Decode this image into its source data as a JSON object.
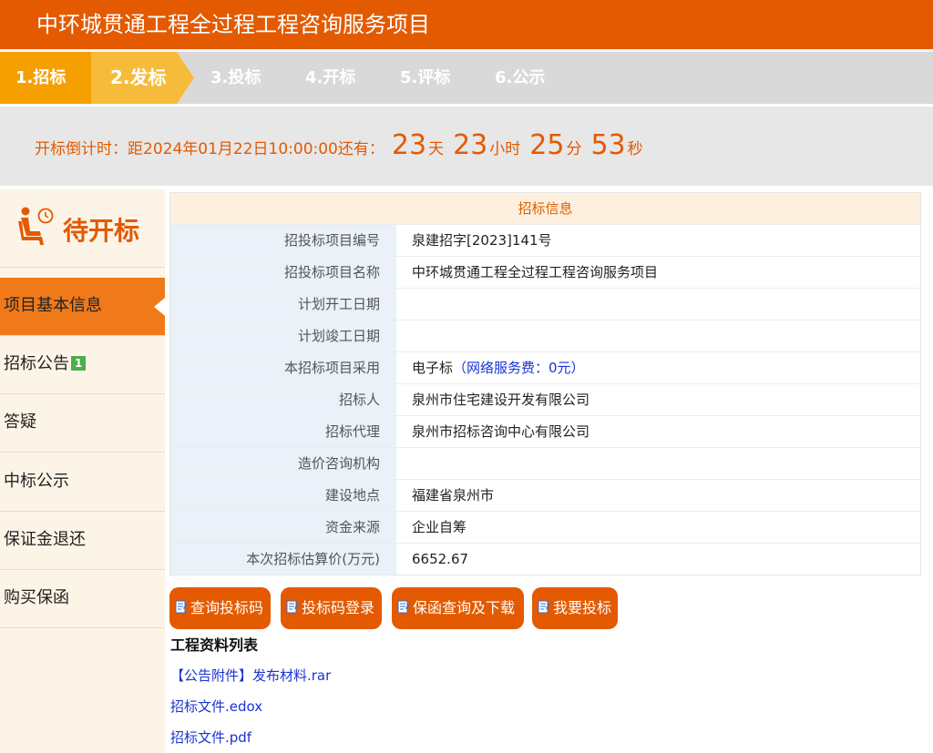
{
  "header": {
    "title": "中环城贯通工程全过程工程咨询服务项目"
  },
  "steps": [
    {
      "label": "1.招标",
      "state": "done"
    },
    {
      "label": "2.发标",
      "state": "current"
    },
    {
      "label": "3.投标",
      "state": "pending"
    },
    {
      "label": "4.开标",
      "state": "pending"
    },
    {
      "label": "5.评标",
      "state": "pending"
    },
    {
      "label": "6.公示",
      "state": "pending"
    }
  ],
  "countdown": {
    "label": "开标倒计时：距2024年01月22日10:00:00还有：",
    "days": "23",
    "days_unit": "天",
    "hours": "23",
    "hours_unit": "小时",
    "minutes": "25",
    "minutes_unit": "分",
    "seconds": "53",
    "seconds_unit": "秒"
  },
  "sidebar": {
    "status": "待开标",
    "status_icon": "person-waiting-clock-icon",
    "items": [
      {
        "label": "项目基本信息",
        "active": true
      },
      {
        "label": "招标公告",
        "badge": "1"
      },
      {
        "label": "答疑"
      },
      {
        "label": "中标公示"
      },
      {
        "label": "保证金退还"
      },
      {
        "label": "购买保函"
      }
    ]
  },
  "info": {
    "title": "招标信息",
    "rows": [
      {
        "label": "招投标项目编号",
        "value": "泉建招字[2023]141号"
      },
      {
        "label": "招投标项目名称",
        "value": "中环城贯通工程全过程工程咨询服务项目"
      },
      {
        "label": "计划开工日期",
        "value": ""
      },
      {
        "label": "计划竣工日期",
        "value": ""
      },
      {
        "label": "本招标项目采用",
        "value": "电子标",
        "note": "（网络服务费：0元）"
      },
      {
        "label": "招标人",
        "value": "泉州市住宅建设开发有限公司"
      },
      {
        "label": "招标代理",
        "value": "泉州市招标咨询中心有限公司"
      },
      {
        "label": "造价咨询机构",
        "value": ""
      },
      {
        "label": "建设地点",
        "value": "福建省泉州市"
      },
      {
        "label": "资金来源",
        "value": "企业自筹"
      },
      {
        "label": "本次招标估算价(万元)",
        "value": "6652.67"
      }
    ]
  },
  "buttons": {
    "query_code": "查询投标码",
    "code_login": "投标码登录",
    "guarantee_query": "保函查询及下载",
    "bid": "我要投标"
  },
  "files": {
    "title": "工程资料列表",
    "items": [
      {
        "label": "【公告附件】发布材料.rar"
      },
      {
        "label": "招标文件.edox"
      },
      {
        "label": "招标文件.pdf"
      }
    ]
  },
  "colors": {
    "brand": "#e35a00",
    "step_done": "#f5a000",
    "step_current": "#f7bb3b",
    "link": "#1a33d1",
    "badge": "#4cae4c"
  }
}
